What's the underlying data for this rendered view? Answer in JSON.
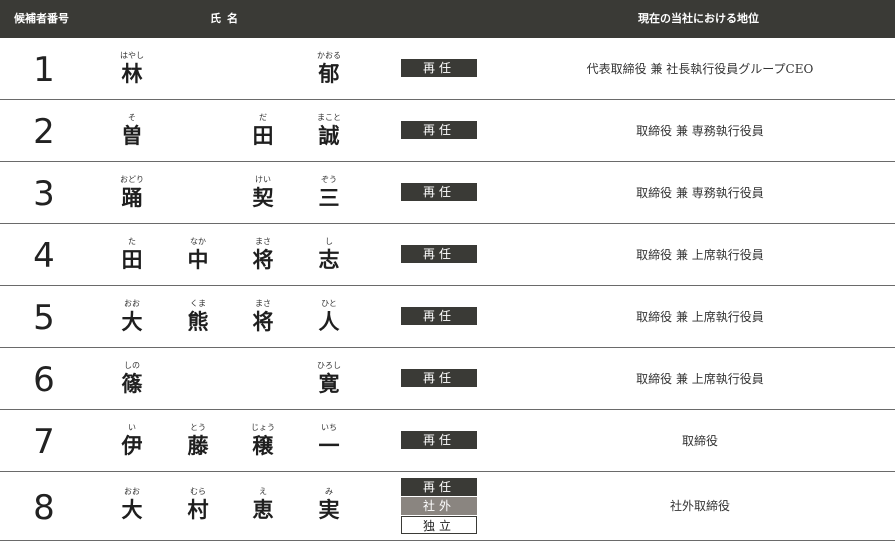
{
  "header": {
    "number_label": "候補者番号",
    "name_label": "氏名",
    "position_label": "現在の当社における地位"
  },
  "colors": {
    "header_bg": "#3a3a36",
    "badge_dark": "#3a3a36",
    "badge_gray": "#8a8580"
  },
  "candidates": [
    {
      "number": "1",
      "name": [
        {
          "ruby": "はやし",
          "char": "林"
        },
        {
          "ruby": "",
          "char": ""
        },
        {
          "ruby": "",
          "char": ""
        },
        {
          "ruby": "かおる",
          "char": "郁"
        }
      ],
      "badges": [
        "再任"
      ],
      "position": "代表取締役 兼 社長執行役員グループCEO"
    },
    {
      "number": "2",
      "name": [
        {
          "ruby": "そ",
          "char": "曽"
        },
        {
          "ruby": "",
          "char": ""
        },
        {
          "ruby": "だ",
          "char": "田"
        },
        {
          "ruby": "まこと",
          "char": "誠"
        }
      ],
      "badges": [
        "再任"
      ],
      "position": "取締役 兼 専務執行役員"
    },
    {
      "number": "3",
      "name": [
        {
          "ruby": "おどり",
          "char": "踊"
        },
        {
          "ruby": "",
          "char": ""
        },
        {
          "ruby": "けい",
          "char": "契"
        },
        {
          "ruby": "ぞう",
          "char": "三"
        }
      ],
      "badges": [
        "再任"
      ],
      "position": "取締役 兼 専務執行役員"
    },
    {
      "number": "4",
      "name": [
        {
          "ruby": "た",
          "char": "田"
        },
        {
          "ruby": "なか",
          "char": "中"
        },
        {
          "ruby": "まさ",
          "char": "将"
        },
        {
          "ruby": "し",
          "char": "志"
        }
      ],
      "badges": [
        "再任"
      ],
      "position": "取締役 兼 上席執行役員"
    },
    {
      "number": "5",
      "name": [
        {
          "ruby": "おお",
          "char": "大"
        },
        {
          "ruby": "くま",
          "char": "熊"
        },
        {
          "ruby": "まさ",
          "char": "将"
        },
        {
          "ruby": "ひと",
          "char": "人"
        }
      ],
      "badges": [
        "再任"
      ],
      "position": "取締役 兼 上席執行役員"
    },
    {
      "number": "6",
      "name": [
        {
          "ruby": "しの",
          "char": "篠"
        },
        {
          "ruby": "",
          "char": ""
        },
        {
          "ruby": "",
          "char": ""
        },
        {
          "ruby": "ひろし",
          "char": "寛"
        }
      ],
      "badges": [
        "再任"
      ],
      "position": "取締役 兼 上席執行役員"
    },
    {
      "number": "7",
      "name": [
        {
          "ruby": "い",
          "char": "伊"
        },
        {
          "ruby": "とう",
          "char": "藤"
        },
        {
          "ruby": "じょう",
          "char": "穣"
        },
        {
          "ruby": "いち",
          "char": "一"
        }
      ],
      "badges": [
        "再任"
      ],
      "position": "取締役"
    },
    {
      "number": "8",
      "name": [
        {
          "ruby": "おお",
          "char": "大"
        },
        {
          "ruby": "むら",
          "char": "村"
        },
        {
          "ruby": "え",
          "char": "恵"
        },
        {
          "ruby": "み",
          "char": "実"
        }
      ],
      "badges": [
        "再任",
        "社外",
        "独立"
      ],
      "position": "社外取締役"
    }
  ]
}
